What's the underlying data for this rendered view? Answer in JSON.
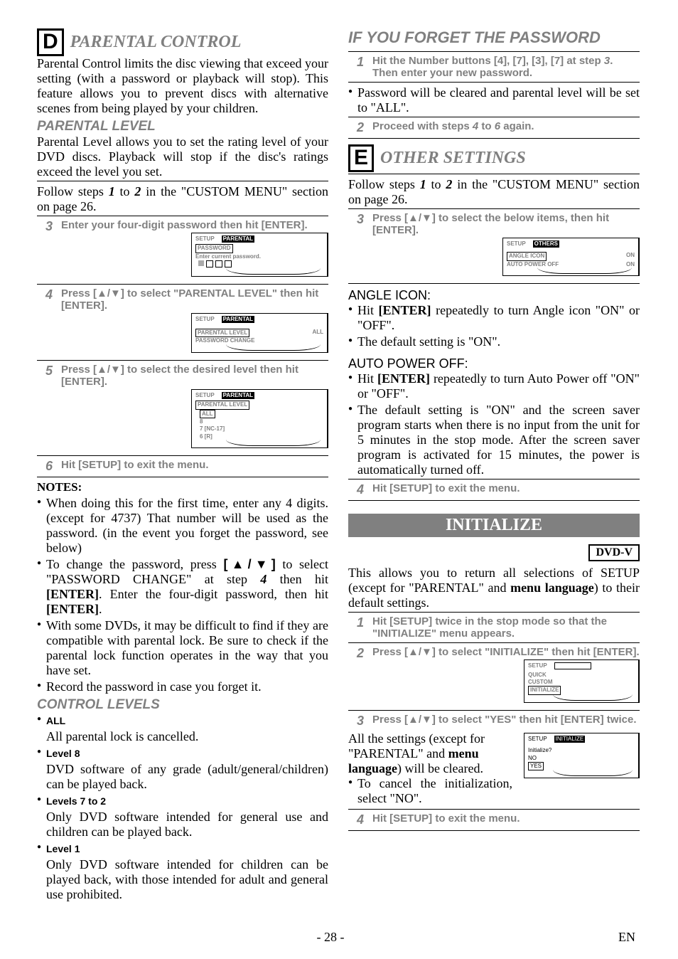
{
  "left": {
    "letter": "D",
    "title": "PARENTAL CONTROL",
    "intro": "Parental Control limits the disc viewing that exceed your setting (with a password or playback will stop). This feature allows you to prevent discs with alternative scenes from being played by your children.",
    "pl_heading": "PARENTAL LEVEL",
    "pl_text": "Parental Level allows you to set the rating level of your DVD discs. Playback will stop if the disc's ratings exceed the level you set.",
    "follow_a": "Follow steps ",
    "follow_b": " to ",
    "follow_c": " in the \"CUSTOM MENU\" section on page 26.",
    "s1": "1",
    "s2": "2",
    "step3n": "3",
    "step3": "Enter your four-digit password then hit [ENTER].",
    "step4n": "4",
    "step4": "Press [▲/▼] to select \"PARENTAL LEVEL\" then hit [ENTER].",
    "step5n": "5",
    "step5": "Press [▲/▼] to select the desired level then hit [ENTER].",
    "step6n": "6",
    "step6": "Hit [SETUP] to exit the menu.",
    "notes_h": "NOTES:",
    "note1": "When doing this for the first time, enter any 4 digits. (except for 4737) That number will be used as the password. (in the event you forget the password, see below)",
    "note2a": "To change the password, press ",
    "note2arrows": "[▲/▼]",
    "note2b": " to select \"PASSWORD CHANGE\" at step ",
    "note2step": "4",
    "note2c": " then hit ",
    "note2enter": "[ENTER]",
    "note2d": ". Enter the four-digit password, then hit ",
    "note2enter2": "[ENTER]",
    "note2e": ".",
    "note3": "With some DVDs, it may be difficult to find if they are compatible with parental lock. Be sure to check if the parental lock function operates in the way that you have set.",
    "note4": "Record the password in case you forget it.",
    "cl_heading": "CONTROL LEVELS",
    "cl": [
      {
        "h": "ALL",
        "t": "All parental lock is cancelled."
      },
      {
        "h": "Level 8",
        "t": "DVD software of any grade (adult/general/children) can be played back."
      },
      {
        "h": "Levels 7 to 2",
        "t": "Only DVD software intended for general use and children can be played back."
      },
      {
        "h": "Level 1",
        "t": "Only DVD software intended for children can be played back, with those intended for adult and general use prohibited."
      }
    ],
    "osd1": {
      "tab1": "SETUP",
      "tab2": "PARENTAL",
      "row1": "PASSWORD",
      "row2": "Enter current password."
    },
    "osd2": {
      "tab1": "SETUP",
      "tab2": "PARENTAL",
      "row1": "PARENTAL LEVEL",
      "row2": "PASSWORD CHANGE",
      "val": "ALL"
    },
    "osd3": {
      "tab1": "SETUP",
      "tab2": "PARENTAL",
      "row1": "PARENTAL LEVEL",
      "r2": "ALL",
      "r3": "8",
      "r4": "7 [NC-17]",
      "r5": "6 [R]"
    }
  },
  "right": {
    "forget_h": "IF YOU FORGET THE PASSWORD",
    "f1n": "1",
    "f1a": "Hit the Number buttons [4], [7], [3], [7] at step ",
    "f1step": "3",
    "f1b": ". Then enter your new password.",
    "fnote": "Password will be cleared and parental level will be set to \"ALL\".",
    "f2n": "2",
    "f2a": "Proceed with steps ",
    "f2s4": "4",
    "f2mid": " to ",
    "f2s6": "6",
    "f2b": " again.",
    "letter": "E",
    "title": "OTHER SETTINGS",
    "follow_a": "Follow steps ",
    "s1": "1",
    "s2": "2",
    "follow_b": " to ",
    "follow_c": " in the \"CUSTOM MENU\" section on page 26.",
    "e3n": "3",
    "e3": "Press [▲/▼] to select the below items, then hit [ENTER].",
    "osdE": {
      "tab1": "SETUP",
      "tab2": "OTHERS",
      "r1": "ANGLE ICON",
      "v1": "ON",
      "r2": "AUTO POWER OFF",
      "v2": "ON"
    },
    "angle_h": "ANGLE ICON:",
    "angle1a": "Hit ",
    "angle1b": "[ENTER]",
    "angle1c": " repeatedly to turn Angle icon \"ON\" or \"OFF\".",
    "angle2": "The default setting is \"ON\".",
    "auto_h": "AUTO POWER OFF:",
    "auto1a": "Hit ",
    "auto1b": "[ENTER]",
    "auto1c": " repeatedly to turn Auto Power off \"ON\" or \"OFF\".",
    "auto2": "The default setting is \"ON\" and the screen saver program starts when there is no input from the unit for 5 minutes in the stop mode. After the screen saver program is activated for 15 minutes, the power is automatically turned off.",
    "e4n": "4",
    "e4": "Hit [SETUP] to exit the menu.",
    "init_band": "INITIALIZE",
    "dvd_box": "DVD-V",
    "init_text_a": "This allows you to return all selections of SETUP (except for \"PARENTAL\" and ",
    "init_text_b": "menu language",
    "init_text_c": ") to their default settings.",
    "i1n": "1",
    "i1": "Hit [SETUP] twice in the stop mode so that the \"INITIALIZE\" menu appears.",
    "i2n": "2",
    "i2": "Press [▲/▼] to select \"INITIALIZE\" then hit [ENTER].",
    "osdI2": {
      "tab1": "SETUP",
      "r1": "QUICK",
      "r2": "CUSTOM",
      "r3": "INITIALIZE"
    },
    "i3n": "3",
    "i3": "Press [▲/▼] to select \"YES\" then hit [ENTER] twice.",
    "i3_body_a": "All the settings (except for \"PARENTAL\" and ",
    "i3_body_b": "menu language",
    "i3_body_c": ") will be cleared.",
    "i3_cancel": "To cancel the initialization, select \"NO\".",
    "osdI3": {
      "tab1": "SETUP",
      "tab2": "INITIALIZE",
      "q": "Initialize?",
      "r1": "NO",
      "r2": "YES"
    },
    "i4n": "4",
    "i4": "Hit [SETUP] to exit the menu."
  },
  "footer": {
    "page": "- 28 -",
    "lang": "EN"
  }
}
